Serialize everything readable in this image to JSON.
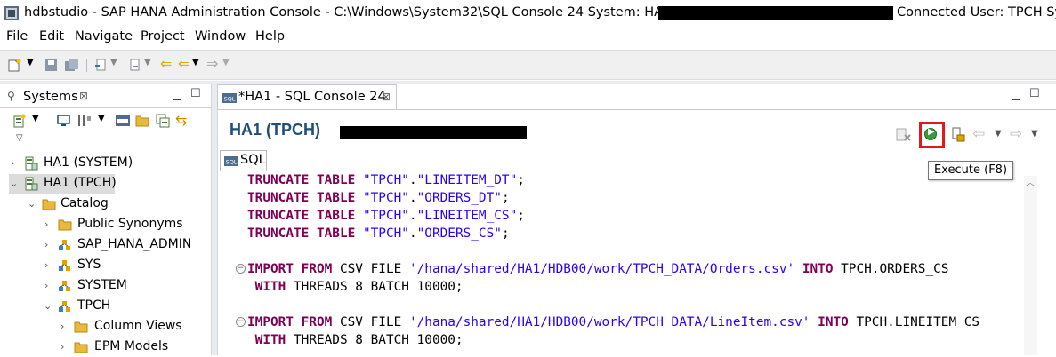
{
  "window": {
    "title_prefix": "hdbstudio - SAP HANA Administration Console - C:\\Windows\\System32\\SQL Console 24 System: HA1 Host:",
    "title_suffix": "Connected User: TPCH Syste"
  },
  "menu": [
    "File",
    "Edit",
    "Navigate",
    "Project",
    "Window",
    "Help"
  ],
  "systems_view": {
    "tab_label": "Systems",
    "close_glyph": "⊠",
    "tree": [
      {
        "label": "HA1 (SYSTEM)",
        "icon": "system-icon",
        "expanded": false
      },
      {
        "label": "HA1 (TPCH)",
        "icon": "system-icon",
        "expanded": true,
        "selected": true
      },
      {
        "label": "Catalog",
        "icon": "folder-icon",
        "expanded": true
      },
      {
        "label": "Public Synonyms",
        "icon": "folder-icon",
        "expanded": false
      },
      {
        "label": "SAP_HANA_ADMIN",
        "icon": "schema-icon",
        "expanded": false
      },
      {
        "label": "SYS",
        "icon": "schema-icon",
        "expanded": false
      },
      {
        "label": "SYSTEM",
        "icon": "schema-icon",
        "expanded": false
      },
      {
        "label": "TPCH",
        "icon": "schema-icon",
        "expanded": true
      },
      {
        "label": "Column Views",
        "icon": "folder-icon",
        "expanded": false
      },
      {
        "label": "EPM Models",
        "icon": "folder-icon",
        "expanded": false
      }
    ]
  },
  "editor": {
    "tab_label": "*HA1 - SQL Console 24",
    "connection_title": "HA1 (TPCH)",
    "sql_tab_label": "SQL",
    "execute_tooltip": "Execute (F8)",
    "code": {
      "t1": [
        "TRUNCATE TABLE",
        " ",
        "\"TPCH\"",
        ".",
        "\"LINEITEM_DT\"",
        ";"
      ],
      "t2": [
        "TRUNCATE TABLE",
        " ",
        "\"TPCH\"",
        ".",
        "\"ORDERS_DT\"",
        ";"
      ],
      "t3": [
        "TRUNCATE TABLE",
        " ",
        "\"TPCH\"",
        ".",
        "\"LINEITEM_CS\"",
        ";"
      ],
      "t4": [
        "TRUNCATE TABLE",
        " ",
        "\"TPCH\"",
        ".",
        "\"ORDERS_CS\"",
        ";"
      ],
      "i1a": [
        "IMPORT",
        " ",
        "FROM",
        " CSV FILE ",
        "'/hana/shared/HA1/HDB00/work/TPCH_DATA/Orders.csv'",
        " ",
        "INTO",
        " TPCH.ORDERS_CS"
      ],
      "i1b": [
        " ",
        "WITH",
        " THREADS 8 BATCH 10000;"
      ],
      "i2a": [
        "IMPORT",
        " ",
        "FROM",
        " CSV FILE ",
        "'/hana/shared/HA1/HDB00/work/TPCH_DATA/LineItem.csv'",
        " ",
        "INTO",
        " TPCH.LINEITEM_CS"
      ],
      "i2b": [
        " ",
        "WITH",
        " THREADS 8 BATCH 10000;"
      ]
    }
  },
  "colors": {
    "keyword": "#7f0055",
    "string": "#2a00ff",
    "connection_title": "#1f4e79",
    "execute_highlight": "#e0191e",
    "execute_icon": "#3a9b3a"
  }
}
